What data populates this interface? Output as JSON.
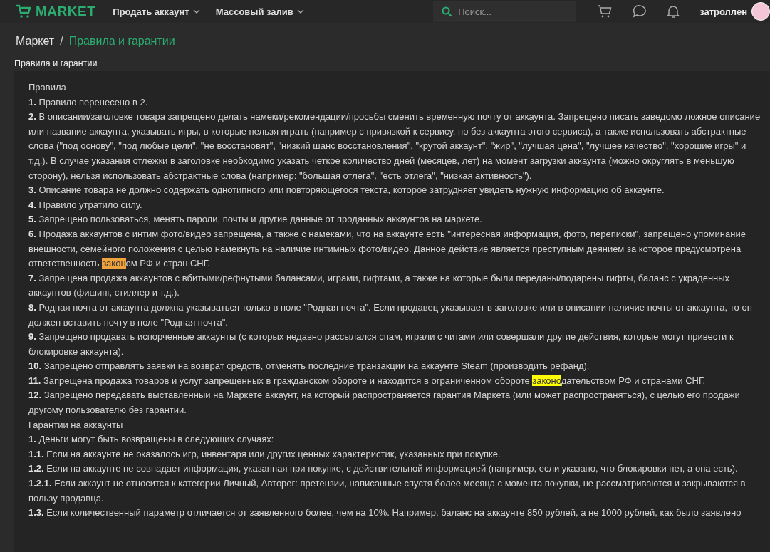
{
  "header": {
    "logo": "MARKET",
    "nav": [
      {
        "label": "Продать аккаунт"
      },
      {
        "label": "Массовый залив"
      }
    ],
    "search": {
      "placeholder": "Поиск..."
    },
    "username": "затроллен"
  },
  "breadcrumb_separator": "/",
  "breadcrumb": [
    {
      "label": "Маркет",
      "current": false
    },
    {
      "label": "Правила и гарантии",
      "current": true
    }
  ],
  "page_title": "Правила и гарантии",
  "paragraphs": [
    {
      "parts": [
        {
          "text": "Правила",
          "kind": "plain"
        }
      ]
    },
    {
      "parts": [
        {
          "text": "**1.** Правило перенесено в 2.",
          "kind": "plain"
        }
      ]
    },
    {
      "parts": [
        {
          "text": "**2.** В описании/заголовке товара запрещено делать намеки/рекомендации/просьбы сменить временную почту от аккаунта. Запрещено писать заведомо ложное описание или название аккаунта, указывать игры, в которые нельзя играть (например с привязкой к сервису, но без аккаунта этого сервиса), а также использовать абстрактные слова (\"под основу\", \"под любые цели\", \"не восстановят\", \"низкий шанс восстановления\", \"крутой аккаунт\", \"жир\", \"лучшая цена\", \"лучшее качество\", \"хорошие игры\" и т.д.). В случае указания отлежки в заголовке необходимо указать четкое количество дней (месяцев, лет) на момент загрузки аккаунта (можно округлять в меньшую сторону), нельзя использовать абстрактные слова (например: \"большая отлега\", \"есть отлега\", \"низкая активность\").",
          "kind": "plain"
        }
      ]
    },
    {
      "parts": [
        {
          "text": "**3.** Описание товара не должно содержать однотипного или повторяющегося текста, которое затрудняет увидеть нужную информацию об аккаунте.",
          "kind": "plain"
        }
      ]
    },
    {
      "parts": [
        {
          "text": "**4.** Правило утратило силу.",
          "kind": "plain"
        }
      ]
    },
    {
      "parts": [
        {
          "text": "**5.** Запрещено пользоваться, менять пароли, почты и другие данные от проданных аккаунтов на маркете.",
          "kind": "plain"
        }
      ]
    },
    {
      "parts": [
        {
          "text": "**6.** Продажа аккаунтов с интим фото/видео запрещена, а также с намеками, что на аккаунте есть \"интересная информация, фото, переписки\", запрещено упоминание внешности, семейного положения с целью намекнуть на наличие интимных фото/видео. Данное действие является преступным деянием за которое предусмотрена ответственность ",
          "kind": "plain"
        },
        {
          "text": "закон",
          "kind": "current-match"
        },
        {
          "text": "ом РФ и стран СНГ.",
          "kind": "plain"
        }
      ]
    },
    {
      "parts": [
        {
          "text": "**7.** Запрещена продажа аккаунтов с вбитыми/рефнутыми балансами, играми, гифтами, а также на которые были переданы/подарены гифты, баланс с украденных аккаунтов (фишинг, стиллер и т.д.).",
          "kind": "plain"
        }
      ]
    },
    {
      "parts": [
        {
          "text": "**8.** Родная почта от аккаунта должна указываться только в поле \"Родная почта\". Если продавец указывает в заголовке или в описании наличие почты от аккаунта, то он должен вставить почту в поле \"Родная почта\".",
          "kind": "plain"
        }
      ]
    },
    {
      "parts": [
        {
          "text": "**9.** Запрещено продавать испорченные аккаунты (с которых недавно рассылался спам, играли с читами или совершали другие действия, которые могут привести к блокировке аккаунта).",
          "kind": "plain"
        }
      ]
    },
    {
      "parts": [
        {
          "text": "**10.** Запрещено отправлять заявки на возврат средств, отменять последние транзакции на аккаунте Steam (производить рефанд).",
          "kind": "plain"
        }
      ]
    },
    {
      "parts": [
        {
          "text": "**11.** Запрещена продажа товаров и услуг запрещенных в гражданском обороте и находится в ограниченном обороте ",
          "kind": "plain"
        },
        {
          "text": "законо",
          "kind": "match"
        },
        {
          "text": "дательством РФ и странами СНГ.",
          "kind": "plain"
        }
      ]
    },
    {
      "parts": [
        {
          "text": "**12.** Запрещено передавать выставленный на Маркете аккаунт, на который распространяется гарантия Маркета (или может распространяться), с целью его продажи другому пользователю без гарантии.",
          "kind": "plain"
        }
      ]
    },
    {
      "parts": [
        {
          "text": "Гарантии на аккаунты",
          "kind": "plain"
        }
      ]
    },
    {
      "parts": [
        {
          "text": "**1.** Деньги могут быть возвращены в следующих случаях:",
          "kind": "plain"
        }
      ]
    },
    {
      "parts": [
        {
          "text": "**1.1.** Если на аккаунте не оказалось игр, инвентаря или других ценных характеристик, указанных при покупке.",
          "kind": "plain"
        }
      ]
    },
    {
      "parts": [
        {
          "text": "**1.2.** Если на аккаунте не совпадает информация, указанная при покупке, с действительной информацией (например, если указано, что блокировки нет, а она есть).",
          "kind": "plain"
        }
      ]
    },
    {
      "parts": [
        {
          "text": "**1.2.1.** Если аккаунт не относится к категории Личный, Авторег: претензии, написанные спустя более месяца с момента покупки, не рассматриваются и закрываются в пользу продавца.",
          "kind": "plain"
        }
      ]
    },
    {
      "parts": [
        {
          "text": "**1.3.** Если количественный параметр отличается от заявленного более, чем на 10%. Например, баланс на аккаунте 850 рублей, а не 1000 рублей, как было заявлено",
          "kind": "plain"
        }
      ]
    }
  ]
}
